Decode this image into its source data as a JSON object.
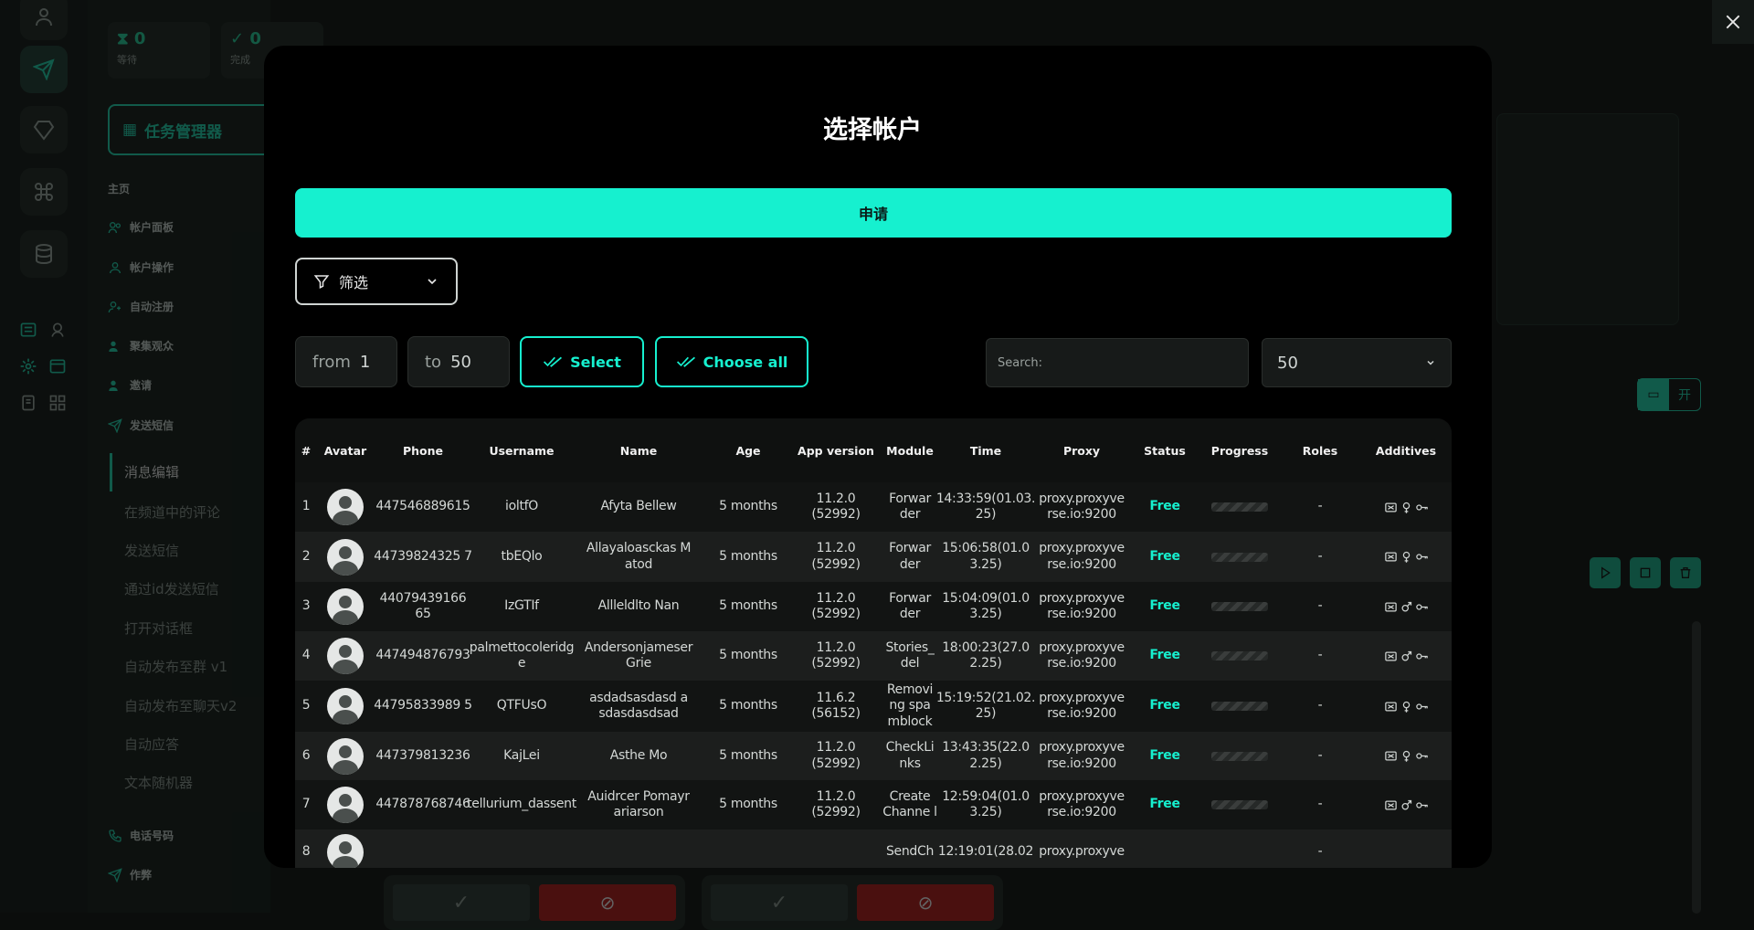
{
  "background": {
    "stats": [
      {
        "label": "等待",
        "value": "0",
        "icon": "hourglass-icon"
      },
      {
        "label": "完成",
        "value": "0",
        "icon": "check-circle-icon"
      }
    ],
    "task_manager_label": "任务管理器",
    "nav": [
      {
        "label": "主页",
        "icon": ""
      },
      {
        "label": "帐户面板",
        "icon": "users-icon"
      },
      {
        "label": "帐户操作",
        "icon": "user-icon"
      },
      {
        "label": "自动注册",
        "icon": "user-plus-icon"
      },
      {
        "label": "聚集观众",
        "icon": "group-icon"
      },
      {
        "label": "邀请",
        "icon": "invite-icon"
      },
      {
        "label": "发送短信",
        "icon": "send-icon"
      }
    ],
    "sub_nav": [
      "消息编辑",
      "在频道中的评论",
      "发送短信",
      "通过id发送短信",
      "打开对话框",
      "自动发布至群 v1",
      "自动发布至聊天v2",
      "自动应答",
      "文本随机器"
    ],
    "nav_bottom": [
      {
        "label": "电话号码",
        "icon": "phone-icon"
      },
      {
        "label": "作弊",
        "icon": "cheat-icon"
      }
    ],
    "open_button_label": "开",
    "close_icon": "close-icon"
  },
  "modal": {
    "title": "选择帐户",
    "apply_label": "申请",
    "filter_label": "筛选",
    "from_label": "from",
    "from_value": "1",
    "to_label": "to",
    "to_value": "50",
    "select_label": "Select",
    "choose_all_label": "Choose all",
    "search_placeholder": "Search:",
    "per_page_value": "50",
    "columns": [
      "#",
      "Avatar",
      "Phone",
      "Username",
      "Name",
      "Age",
      "App version",
      "Module",
      "Time",
      "Proxy",
      "Status",
      "Progress",
      "Roles",
      "Additives"
    ],
    "rows": [
      {
        "n": "1",
        "phone": "447546889615",
        "username": "ioltfO",
        "name": "Afyta Bellew",
        "age": "5 months",
        "app": "11.2.0 (52992)",
        "module": "Forwar der",
        "time": "14:33:59(01.03. 25)",
        "proxy": "proxy.proxyve rse.io:9200",
        "status": "Free",
        "roles": "-",
        "gender": "female"
      },
      {
        "n": "2",
        "phone": "44739824325 7",
        "username": "tbEQlo",
        "name": "Allayaloasckas M atod",
        "age": "5 months",
        "app": "11.2.0 (52992)",
        "module": "Forwar der",
        "time": "15:06:58(01.0 3.25)",
        "proxy": "proxy.proxyve rse.io:9200",
        "status": "Free",
        "roles": "-",
        "gender": "female"
      },
      {
        "n": "3",
        "phone": "44079439166 65",
        "username": "IzGTIf",
        "name": "Allleldlto Nan",
        "age": "5 months",
        "app": "11.2.0 (52992)",
        "module": "Forwar der",
        "time": "15:04:09(01.0 3.25)",
        "proxy": "proxy.proxyve rse.io:9200",
        "status": "Free",
        "roles": "-",
        "gender": "male"
      },
      {
        "n": "4",
        "phone": "447494876793",
        "username": "palmettocoleridg e",
        "name": "Andersonjameser Grie",
        "age": "5 months",
        "app": "11.2.0 (52992)",
        "module": "Stories_ del",
        "time": "18:00:23(27.0 2.25)",
        "proxy": "proxy.proxyve rse.io:9200",
        "status": "Free",
        "roles": "-",
        "gender": "male"
      },
      {
        "n": "5",
        "phone": "44795833989 5",
        "username": "QTFUsO",
        "name": "asdadsasdasd a sdasdasdsad",
        "age": "5 months",
        "app": "11.6.2 (56152)",
        "module": "Removi ng spa mblock",
        "time": "15:19:52(21.02. 25)",
        "proxy": "proxy.proxyve rse.io:9200",
        "status": "Free",
        "roles": "-",
        "gender": "female"
      },
      {
        "n": "6",
        "phone": "447379813236",
        "username": "KajLei",
        "name": "Asthe Mo",
        "age": "5 months",
        "app": "11.2.0 (52992)",
        "module": "CheckLi nks",
        "time": "13:43:35(22.0 2.25)",
        "proxy": "proxy.proxyve rse.io:9200",
        "status": "Free",
        "roles": "-",
        "gender": "female"
      },
      {
        "n": "7",
        "phone": "447878768746",
        "username": "tellurium_dassent",
        "name": "Auidrcer Pomayr ariarson",
        "age": "5 months",
        "app": "11.2.0 (52992)",
        "module": "Create Channe l",
        "time": "12:59:04(01.0 3.25)",
        "proxy": "proxy.proxyve rse.io:9200",
        "status": "Free",
        "roles": "-",
        "gender": "male"
      },
      {
        "n": "8",
        "phone": "",
        "username": "",
        "name": "",
        "age": "",
        "app": "",
        "module": "SendCh",
        "time": "12:19:01(28.02",
        "proxy": "proxy.proxyve",
        "status": "",
        "roles": "-",
        "gender": ""
      }
    ]
  },
  "colors": {
    "accent": "#16f0cf",
    "status_free": "#16f0cf",
    "danger": "#b01515"
  }
}
